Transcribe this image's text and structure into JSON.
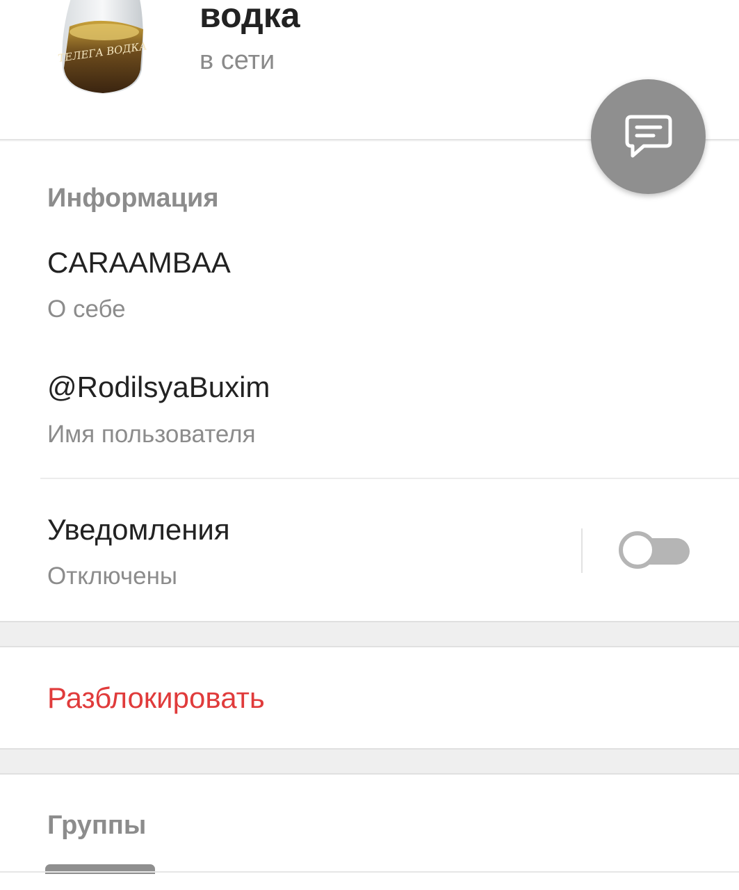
{
  "profile": {
    "name": "водка",
    "status": "в сети",
    "avatar_label": "ТЕЛЕГА ВОДКА"
  },
  "fab": {
    "icon": "message-icon"
  },
  "info": {
    "section_title": "Информация",
    "bio_value": "CARAAMBAA",
    "bio_label": "О себе",
    "username_value": "@RodilsyaBuxim",
    "username_label": "Имя пользователя"
  },
  "notifications": {
    "title": "Уведомления",
    "state_label": "Отключены",
    "enabled": false
  },
  "actions": {
    "unblock_label": "Разблокировать"
  },
  "groups": {
    "section_title": "Группы"
  },
  "colors": {
    "danger": "#e03b3b",
    "muted": "#8c8c8c",
    "fab": "#8f8f8f"
  }
}
